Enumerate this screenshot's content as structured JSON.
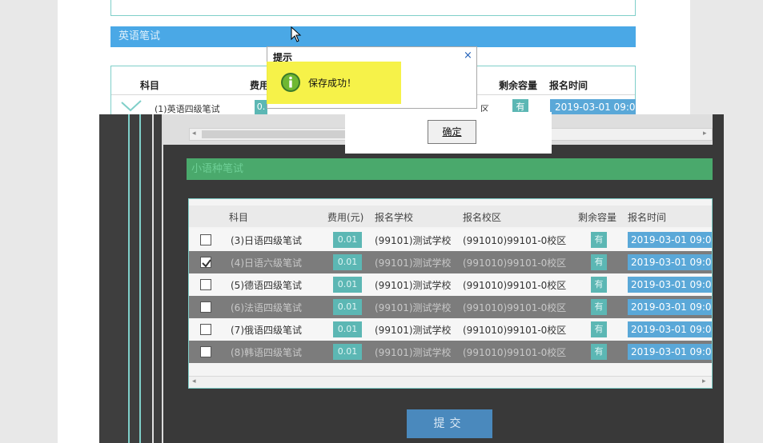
{
  "english_section": {
    "title": "英语笔试",
    "columns": [
      "科目",
      "费用",
      "剩余容量",
      "报名时间"
    ],
    "row1": {
      "subject": "(1)英语四级笔试",
      "fee": "0.",
      "campus_partial": "区",
      "capacity": "有",
      "time": "2019-03-01 09:0"
    }
  },
  "minor_section": {
    "title": "小语种笔试",
    "columns": [
      "科目",
      "费用(元)",
      "报名学校",
      "报名校区",
      "剩余容量",
      "报名时间"
    ],
    "rows": [
      {
        "subject": "(3)日语四级笔试",
        "fee": "0.01",
        "school": "(99101)测试学校",
        "campus": "(991010)99101-0校区",
        "capacity": "有",
        "time": "2019-03-01 09:0",
        "checked": false,
        "glitch": false
      },
      {
        "subject": "(4)日语六级笔试",
        "fee": "0.01",
        "school": "(99101)测试学校",
        "campus": "(991010)99101-0校区",
        "capacity": "有",
        "time": "2019-03-01 09:0",
        "checked": true,
        "glitch": true
      },
      {
        "subject": "(5)德语四级笔试",
        "fee": "0.01",
        "school": "(99101)测试学校",
        "campus": "(991010)99101-0校区",
        "capacity": "有",
        "time": "2019-03-01 09:0",
        "checked": false,
        "glitch": false
      },
      {
        "subject": "(6)法语四级笔试",
        "fee": "0.01",
        "school": "(99101)测试学校",
        "campus": "(991010)99101-0校区",
        "capacity": "有",
        "time": "2019-03-01 09:0",
        "checked": false,
        "glitch": true
      },
      {
        "subject": "(7)俄语四级笔试",
        "fee": "0.01",
        "school": "(99101)测试学校",
        "campus": "(991010)99101-0校区",
        "capacity": "有",
        "time": "2019-03-01 09:0",
        "checked": false,
        "glitch": false
      },
      {
        "subject": "(8)韩语四级笔试",
        "fee": "0.01",
        "school": "(99101)测试学校",
        "campus": "(991010)99101-0校区",
        "capacity": "有",
        "time": "2019-03-01 09:0",
        "checked": false,
        "glitch": true
      }
    ]
  },
  "submit_label": "提交",
  "dialog": {
    "title": "提示",
    "close": "×",
    "message": "保存成功！",
    "ok_label": "确定"
  },
  "colors": {
    "english_header": "#4aa8e6",
    "minor_header": "#4aa96c",
    "highlight": "#f5f13a",
    "teal": "#5cb7b4",
    "date_blue": "#5aa8d8"
  }
}
